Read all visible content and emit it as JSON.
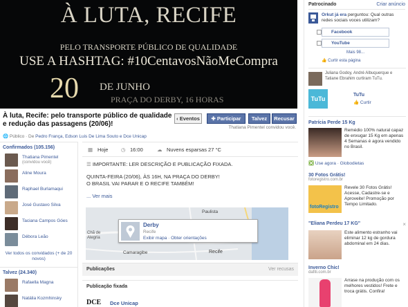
{
  "banner": {
    "line1": "À LUTA, RECIFE",
    "line2": "PELO TRANSPORTE PÚBLICO DE QUALIDADE",
    "line3": "USE A HASHTAG: #10CentavosNãoMeCompra",
    "day": "20",
    "month": "DE JUNHO",
    "place": "PRAÇA DO DERBY, 16 HORAS"
  },
  "event": {
    "title": "À luta, Recife: pelo transporte público de qualidade e redução das passagens (20/06)!",
    "inviter": "Thatiana Pimentel convidou você.",
    "privacy_prefix": "Público · De",
    "hosts": "Pedro França, Edson Luis De Lima Souto e Dce Unicap"
  },
  "actions": {
    "events_label": "‹ Eventos",
    "join_label": "Participar",
    "maybe_label": "Talvez",
    "decline_label": "Recusar"
  },
  "confirmed": {
    "header": "Confirmados (105.156)",
    "people": [
      {
        "name": "Thatiana Pimentel",
        "sub": "(convidou você)"
      },
      {
        "name": "Aline Moura",
        "sub": ""
      },
      {
        "name": "Raphael Burlamaqui",
        "sub": ""
      },
      {
        "name": "José Gustavo Silva",
        "sub": ""
      },
      {
        "name": "Taciana Campos Góes",
        "sub": ""
      },
      {
        "name": "Débora Leão",
        "sub": ""
      }
    ],
    "see_all": "Ver todos os convidados (+ de 20 novos)"
  },
  "maybe": {
    "header": "Talvez (24.340)",
    "people": [
      {
        "name": "Rafaella Magna"
      },
      {
        "name": "Natália Kozmhinsky"
      }
    ]
  },
  "details": {
    "date": "Hoje",
    "time": "16:00",
    "weather": "Nuvens esparsas 27 °C",
    "desc1": "IMPORTANTE: LER DESCRIÇÃO E PUBLICAÇÃO FIXADA.",
    "desc2": "QUINTA-FEIRA (20/06), ÀS 16H, NA PRAÇA DO DERBY!",
    "desc3": "O BRASIL VAI PARAR E O RECIFE TAMBÉM!",
    "see_more": "... Ver mais"
  },
  "map": {
    "place_name": "Derby",
    "city": "Recife",
    "links": "Exibir mapa · Obter orientações",
    "label_paulista": "Paulista",
    "label_recife": "Recife",
    "label_cha": "Chã de Alegria",
    "label_camaragibe": "Camaragibe"
  },
  "posts": {
    "header": "Publicações",
    "see_refusals": "Ver recusas",
    "pinned": "Publicação fixada",
    "pinned_author": "Dce Unicap"
  },
  "sidebar": {
    "sponsored": "Patrocinado",
    "create_ad": "Criar anúncio",
    "poll_title": "Orkut já era",
    "poll_question": "perguntou: Qual outras redes sociais voces utilizam?",
    "poll_options": [
      "Facebook",
      "YouTube"
    ],
    "poll_more": "Mais 98...",
    "poll_like": "Curtir esta página",
    "tutu_likers": "Juliana Godoy, André Albuquerque e Tatiane Ebrahim curtiram TuTu.",
    "tutu_name": "TuTu",
    "tutu_logo": "TuTu",
    "tutu_like": "Curtir",
    "ad1_title": "Patrícia Perde 15 Kg",
    "ad1_text": "Remédio 100% natural capaz de enxugar 15 Kg em apenas 4 Semanas é agora vendido no Brasil.",
    "ad1_use": "Use agora · Globodietas",
    "ad2_title": "30 Fotos Grátis!",
    "ad2_url": "fotoregistro.com.br",
    "ad2_text": "Revele 30 Fotos Grátis! Acesse, Cadastre-se e Aproveite! Promoção por Tempo Limitado.",
    "ad2_logo": "fotoRegistro",
    "ad3_title": "\"Eliana Perdeu 17 KG\"",
    "ad3_text": "Este alimento estranho vai eliminar 12 kg de gordura abdominal em 24 dias.",
    "ad4_title": "Inverno Chic!",
    "ad4_url": "dafiti.com.br",
    "ad4_text": "Arrase na produção com os melhores vestidos! Frete e troca grátis. Confira!"
  }
}
